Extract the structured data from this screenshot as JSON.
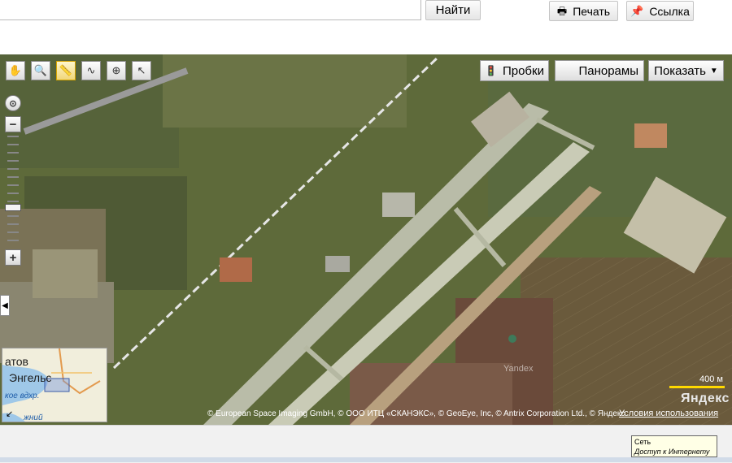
{
  "search": {
    "value": "",
    "find_label": "Найти"
  },
  "header": {
    "print_label": "Печать",
    "link_label": "Ссылка"
  },
  "toolbar": {
    "tools": [
      {
        "name": "hand-tool",
        "icon": "hand-icon",
        "glyph": "✋",
        "active": false
      },
      {
        "name": "magnifier-tool",
        "icon": "magnifier-icon",
        "glyph": "🔍",
        "active": false
      },
      {
        "name": "ruler-tool",
        "icon": "ruler-icon",
        "glyph": "📏",
        "active": true
      },
      {
        "name": "route-tool",
        "icon": "route-icon",
        "glyph": "∿",
        "active": false
      },
      {
        "name": "marker-tool",
        "icon": "marker-icon",
        "glyph": "⊕",
        "active": false
      },
      {
        "name": "select-tool",
        "icon": "cursor-icon",
        "glyph": "↖",
        "active": false
      }
    ]
  },
  "map_controls": {
    "traffic_label": "Пробки",
    "panorama_label": "Панорамы",
    "show_label": "Показать"
  },
  "minimap": {
    "city_top": "атов",
    "city": "Энгельс",
    "water": "кое вдхр.",
    "bottom": "жний"
  },
  "map": {
    "watermark": "Yandex",
    "scale_label": "400 м",
    "logo": "Яндекс",
    "copyright": "© European Space Imaging GmbH, © ООО ИТЦ «СКАНЭКС», © GeoEye, Inc, © Antrix Corporation Ltd., © Яндекс",
    "terms_label": "Условия использования"
  },
  "status_tooltip": {
    "title": "Сеть",
    "text": "Доступ к Интернету"
  },
  "colors": {
    "runway": "#c9cbb6",
    "field": "#5f6a3a",
    "scale_bar": "#ffd900"
  }
}
